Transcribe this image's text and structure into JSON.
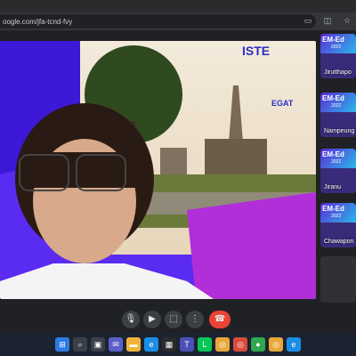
{
  "browser": {
    "url": "oogle.com/jfa-tcnd-fvy",
    "icons": [
      "camera-icon",
      "cast-icon",
      "star-icon"
    ]
  },
  "main_video": {
    "background_colors": {
      "purple": "#5a2bf0",
      "magenta": "#b02fd9",
      "sky": "#f1e6cf"
    },
    "banner_text": "ISTE",
    "sponsor": "EGAT"
  },
  "participants": [
    {
      "banner": "EM-Ed",
      "sub": "2022",
      "name": "Jirutthapo"
    },
    {
      "banner": "EM-Ed",
      "sub": "2022",
      "name": "Nampeung"
    },
    {
      "banner": "EM-Ed",
      "sub": "2022",
      "name": "Jiranu"
    },
    {
      "banner": "EM-Ed",
      "sub": "2022",
      "name": "Chawapon"
    }
  ],
  "controls": {
    "mic": "mic-icon",
    "camera": "video-icon",
    "present": "present-icon",
    "more": "more-icon",
    "end": "end-call-icon"
  },
  "taskbar": {
    "icons": [
      "windows-icon",
      "search-icon",
      "task-view-icon",
      "chat-icon",
      "explorer-icon",
      "edge-icon",
      "store-icon",
      "teams-icon",
      "line-icon",
      "chrome-icon",
      "chrome-icon-2",
      "green-app-icon",
      "chrome-icon-3",
      "edge-icon-2"
    ]
  }
}
